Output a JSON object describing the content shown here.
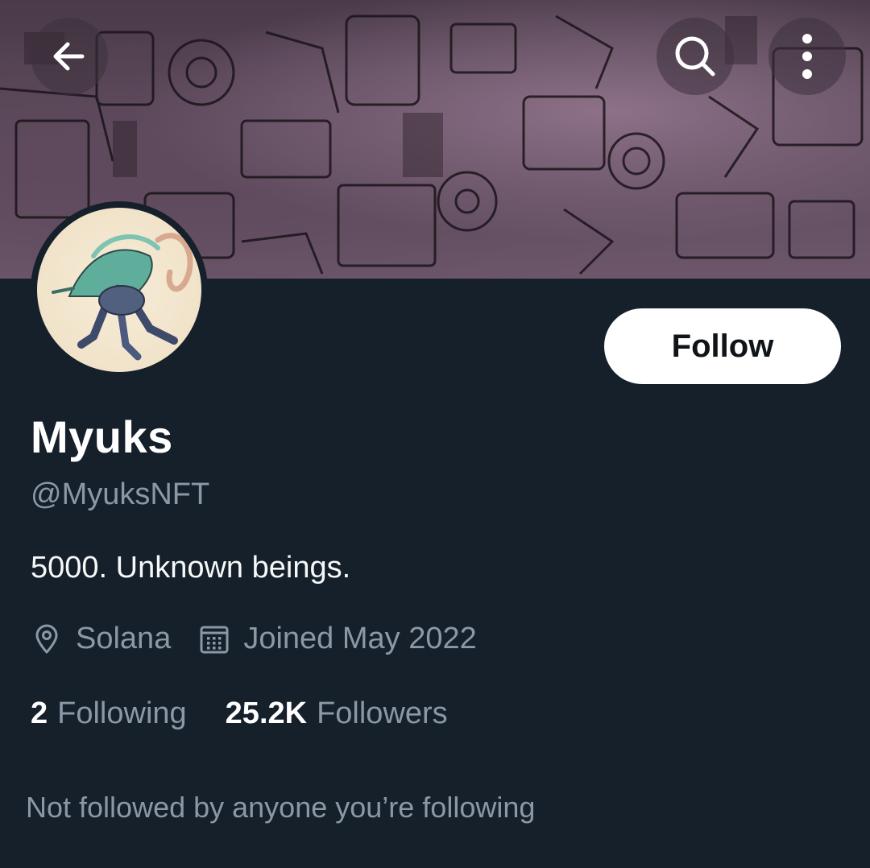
{
  "header": {
    "back_icon": "arrow-left-icon",
    "search_icon": "search-icon",
    "more_icon": "more-vertical-icon"
  },
  "profile": {
    "display_name": "Myuks",
    "handle": "@MyuksNFT",
    "bio": "5000. Unknown beings.",
    "location": "Solana",
    "location_icon": "location-pin-icon",
    "joined": "Joined May 2022",
    "joined_icon": "calendar-icon",
    "follow_label": "Follow"
  },
  "stats": {
    "following_count": "2",
    "following_label": "Following",
    "followers_count": "25.2K",
    "followers_label": "Followers"
  },
  "social_context": "Not followed by anyone you’re following",
  "colors": {
    "background": "#15202b",
    "secondary_text": "#8b98a5",
    "follow_button_bg": "#ffffff",
    "follow_button_text": "#0f1419"
  }
}
